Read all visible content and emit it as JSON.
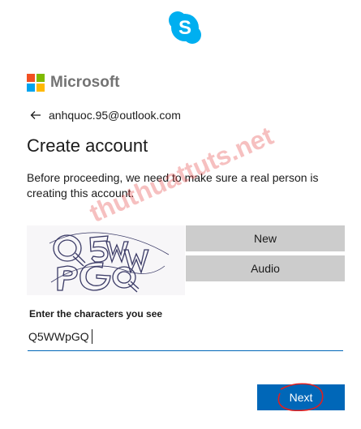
{
  "brand": {
    "name": "Microsoft",
    "app_icon": "skype-icon",
    "logo_icon": "microsoft-logo-icon"
  },
  "identity": {
    "email": "anhquoc.95@outlook.com",
    "back_icon": "arrow-left-icon"
  },
  "page": {
    "title": "Create account",
    "description": "Before proceeding, we need to make sure a real person is creating this account."
  },
  "captcha": {
    "text_shown": "Q5WW PGQ",
    "new_label": "New",
    "audio_label": "Audio"
  },
  "form": {
    "label": "Enter the characters you see",
    "value": "Q5WWpGQ"
  },
  "actions": {
    "next_label": "Next"
  },
  "watermark": {
    "text": "thuthuattuts.net"
  },
  "colors": {
    "primary": "#0067b8",
    "secondary_button": "#cccccc",
    "text": "#1b1b1b",
    "skype": "#00aff0",
    "annotation": "#e02020"
  }
}
